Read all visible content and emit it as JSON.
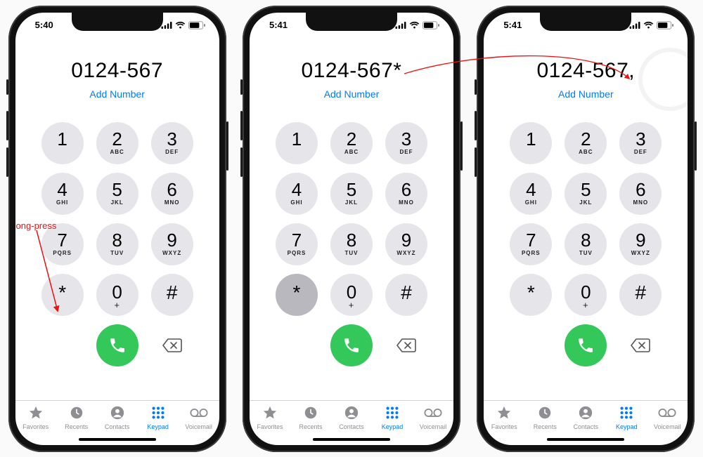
{
  "phones": [
    {
      "time": "5:40",
      "dialed": "0124-567",
      "add_number": "Add Number",
      "pressed_key": null,
      "annotation": "long-press"
    },
    {
      "time": "5:41",
      "dialed": "0124-567*",
      "add_number": "Add Number",
      "pressed_key": "*",
      "annotation": null
    },
    {
      "time": "5:41",
      "dialed": "0124-567,",
      "add_number": "Add Number",
      "pressed_key": null,
      "annotation": null
    }
  ],
  "keypad": [
    {
      "digit": "1",
      "letters": ""
    },
    {
      "digit": "2",
      "letters": "ABC"
    },
    {
      "digit": "3",
      "letters": "DEF"
    },
    {
      "digit": "4",
      "letters": "GHI"
    },
    {
      "digit": "5",
      "letters": "JKL"
    },
    {
      "digit": "6",
      "letters": "MNO"
    },
    {
      "digit": "7",
      "letters": "PQRS"
    },
    {
      "digit": "8",
      "letters": "TUV"
    },
    {
      "digit": "9",
      "letters": "WXYZ"
    },
    {
      "digit": "*",
      "letters": ""
    },
    {
      "digit": "0",
      "letters": "+"
    },
    {
      "digit": "#",
      "letters": ""
    }
  ],
  "tabs": [
    {
      "id": "favorites",
      "label": "Favorites"
    },
    {
      "id": "recents",
      "label": "Recents"
    },
    {
      "id": "contacts",
      "label": "Contacts"
    },
    {
      "id": "keypad",
      "label": "Keypad"
    },
    {
      "id": "voicemail",
      "label": "Voicemail"
    }
  ],
  "active_tab": "keypad"
}
